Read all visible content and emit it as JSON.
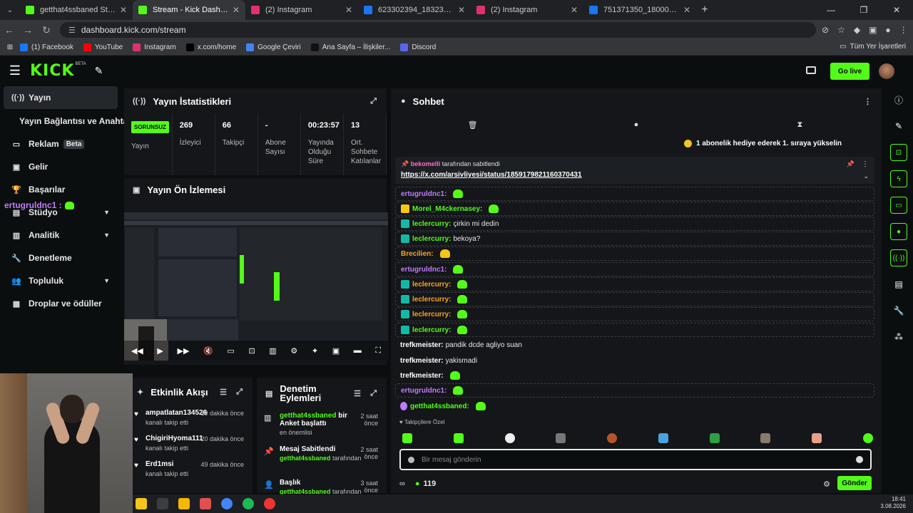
{
  "browser": {
    "tabs": [
      {
        "title": "getthat4ssbaned Stream - Watc",
        "color": "#53fc18",
        "active": false
      },
      {
        "title": "Stream - Kick Dashboard",
        "color": "#53fc18",
        "active": true
      },
      {
        "title": "(2) Instagram",
        "color": "#e1306c",
        "active": false
      },
      {
        "title": "623302394_183238613412214",
        "color": "#1877f2",
        "active": false
      },
      {
        "title": "(2) Instagram",
        "color": "#e1306c",
        "active": false
      },
      {
        "title": "751371350_180001319879758",
        "color": "#1877f2",
        "active": false
      }
    ],
    "url": "dashboard.kick.com/stream",
    "bookmarks": [
      {
        "label": "(1) Facebook",
        "color": "#1877f2"
      },
      {
        "label": "YouTube",
        "color": "#ff0000"
      },
      {
        "label": "Instagram",
        "color": "#e1306c"
      },
      {
        "label": "x.com/home",
        "color": "#000000"
      },
      {
        "label": "Google Çeviri",
        "color": "#4285f4"
      },
      {
        "label": "Ana Sayfa – İlişkiler...",
        "color": "#111111"
      },
      {
        "label": "Discord",
        "color": "#5865f2"
      }
    ],
    "bookmarks_right": "Tüm Yer İşaretleri"
  },
  "topbar": {
    "logo": "KICK",
    "logo_sup": "BETA",
    "go_live": "Go live"
  },
  "sidebar": {
    "items": [
      {
        "label": "Yayın",
        "icon": "broadcast-icon",
        "glyph": "((·))"
      },
      {
        "label": "Yayın Bağlantısı ve Anahtarı",
        "icon": "",
        "glyph": ""
      },
      {
        "label": "Reklam",
        "icon": "ad-icon",
        "glyph": "▭",
        "badge": "Beta"
      },
      {
        "label": "Gelir",
        "icon": "income-icon",
        "glyph": "▣"
      },
      {
        "label": "Başarılar",
        "icon": "trophy-icon",
        "glyph": "🏆"
      },
      {
        "label": "Stüdyo",
        "icon": "studio-icon",
        "glyph": "▤"
      },
      {
        "label": "Analitik",
        "icon": "analytics-icon",
        "glyph": "▥"
      },
      {
        "label": "Denetleme",
        "icon": "wrench-icon",
        "glyph": "🔧"
      },
      {
        "label": "Topluluk",
        "icon": "community-icon",
        "glyph": "👥"
      },
      {
        "label": "Droplar ve ödüller",
        "icon": "drops-icon",
        "glyph": "▦"
      }
    ],
    "overlay_user": "ertugruldnc1 :"
  },
  "stats_panel": {
    "title": "Yayın İstatistikleri",
    "status": "SORUNSUZ",
    "status_label": "Yayın",
    "stats": [
      {
        "value": "269",
        "label": "İzleyici"
      },
      {
        "value": "66",
        "label": "Takipçi"
      },
      {
        "value": "-",
        "label": "Abone Sayısı"
      },
      {
        "value": "00:23:57",
        "label": "Yayında Olduğu Süre"
      },
      {
        "value": "13",
        "label": "Ort. Sohbete Katılanlar"
      }
    ]
  },
  "preview_panel": {
    "title": "Yayın Ön İzlemesi"
  },
  "activity_panel": {
    "title": "Etkinlik Akışı",
    "items": [
      {
        "name": "ampatlatan134526",
        "desc": "kanalı takip etti",
        "time": "19 dakika önce"
      },
      {
        "name": "ChigiriHyoma111",
        "desc": "kanalı takip etti",
        "time": "20 dakika önce"
      },
      {
        "name": "Erd1msi",
        "desc": "kanalı takip etti",
        "time": "49 dakika önce"
      }
    ]
  },
  "moderation_panel": {
    "title": "Denetim Eylemleri",
    "items": [
      {
        "icon": "poll-icon",
        "glyph": "▥",
        "name_green": "getthat4ssbaned",
        "name": " bir Anket başlattı",
        "desc": "en önemlisi",
        "time": "2 saat önce"
      },
      {
        "icon": "pin-icon",
        "glyph": "📌",
        "name_green": "",
        "name": "Mesaj Sabitlendi",
        "desc_green": "getthat4ssbaned",
        "desc": " tarafından",
        "time": "2 saat önce"
      },
      {
        "icon": "users-icon",
        "glyph": "👤",
        "name_green": "",
        "name": "Başlık",
        "desc_green": "getthat4ssbaned",
        "desc": " tarafından",
        "time": "3 saat önce"
      }
    ]
  },
  "chat": {
    "title": "Sohbet",
    "sub_banner": "1 abonelik hediye ederek 1. sıraya yükselin",
    "pinned_by": "bekomelli",
    "pinned_suffix": " tarafından sabitlendi",
    "pinned_link": "https://x.com/arsivliyesi/status/1859179821160370431",
    "messages": [
      {
        "user": "ertugruldnc1:",
        "color": "#c27aff",
        "text": "",
        "emote": "green",
        "badge": "",
        "boxed": true
      },
      {
        "user": "Morel_M4ckernasey:",
        "color": "#53fc18",
        "text": "",
        "emote": "green",
        "badge": "crown",
        "boxed": true
      },
      {
        "user": "leclercurry:",
        "color": "#53fc18",
        "text": "çirkin mi dedin",
        "emote": "",
        "badge": "sub",
        "boxed": true
      },
      {
        "user": "leclercurry:",
        "color": "#53fc18",
        "text": "bekoya?",
        "emote": "",
        "badge": "sub",
        "boxed": true
      },
      {
        "user": "Brecilien:",
        "color": "#f5a623",
        "text": "",
        "emote": "yellow",
        "badge": "",
        "boxed": true
      },
      {
        "user": "ertugruldnc1:",
        "color": "#c27aff",
        "text": "",
        "emote": "green",
        "badge": "",
        "boxed": true
      },
      {
        "user": "leclercurry:",
        "color": "#f5a623",
        "text": "",
        "emote": "green",
        "badge": "sub",
        "boxed": true
      },
      {
        "user": "leclercurry:",
        "color": "#f5a623",
        "text": "",
        "emote": "green",
        "badge": "sub",
        "boxed": true
      },
      {
        "user": "leclercurry:",
        "color": "#f5a623",
        "text": "",
        "emote": "green",
        "badge": "sub",
        "boxed": true
      },
      {
        "user": "leclercurry:",
        "color": "#53fc18",
        "text": "",
        "emote": "green",
        "badge": "sub",
        "boxed": true
      },
      {
        "user": "trefkmeister:",
        "color": "#ffffff",
        "text": "pandik dcde agliyo suan",
        "emote": "",
        "badge": "",
        "boxed": false
      },
      {
        "user": "trefkmeister:",
        "color": "#ffffff",
        "text": "yakismadi",
        "emote": "",
        "badge": "",
        "boxed": false
      },
      {
        "user": "trefkmeister:",
        "color": "#ffffff",
        "text": "",
        "emote": "green",
        "badge": "",
        "boxed": false
      },
      {
        "user": "ertugruldnc1:",
        "color": "#c27aff",
        "text": "",
        "emote": "green",
        "badge": "",
        "boxed": true
      },
      {
        "user": "getthat4ssbaned:",
        "color": "#53fc18",
        "text": "",
        "emote": "green",
        "badge": "mic",
        "boxed": false
      }
    ],
    "followers_only": "Takipçilere Özel",
    "input_placeholder": "Bir mesaj gönderin",
    "viewer_count": "119",
    "send": "Gönder"
  },
  "taskbar": {
    "time": "18:41",
    "date": "3.08.2026"
  }
}
